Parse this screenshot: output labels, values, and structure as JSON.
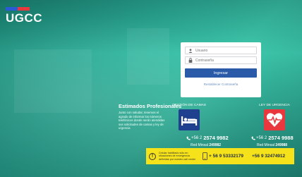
{
  "brand": {
    "name": "UGCC",
    "flag_colors": [
      "#2a5bd7",
      "#e8383d"
    ]
  },
  "login": {
    "user_placeholder": "Usuario",
    "password_placeholder": "Contraseña",
    "submit_label": "Ingresar",
    "forgot_label": "Restablecer Contraseña"
  },
  "info": {
    "title": "Estimados Profesionales",
    "text": "Junto con saludar, tenemos el agrado de informar los números telefónicos donde serán atendidas sus solicitudes de camas y ley de urgencia"
  },
  "columns": [
    {
      "title": "GESTIÓN DE CAMAS",
      "icon": "hospital-bed-icon",
      "icon_bg": "#1f3f8f",
      "phone_prefix": "+56 2",
      "phone": "2574 9982",
      "minsal_label": "Red Minsal",
      "minsal": "249982"
    },
    {
      "title": "LEY DE URGENCIA",
      "icon": "heart-pulse-icon",
      "icon_bg": "#e8383d",
      "phone_prefix": "+56 2",
      "phone": "2574 9988",
      "minsal_label": "Red Minsal",
      "minsal": "249988"
    }
  ],
  "banner": {
    "text": "Celular habilitado sólo en situaciones de emergencia definidas por nuestro call center",
    "mobile_1": "+ 56 9 53332179",
    "mobile_2": "+56 9 32474912"
  }
}
